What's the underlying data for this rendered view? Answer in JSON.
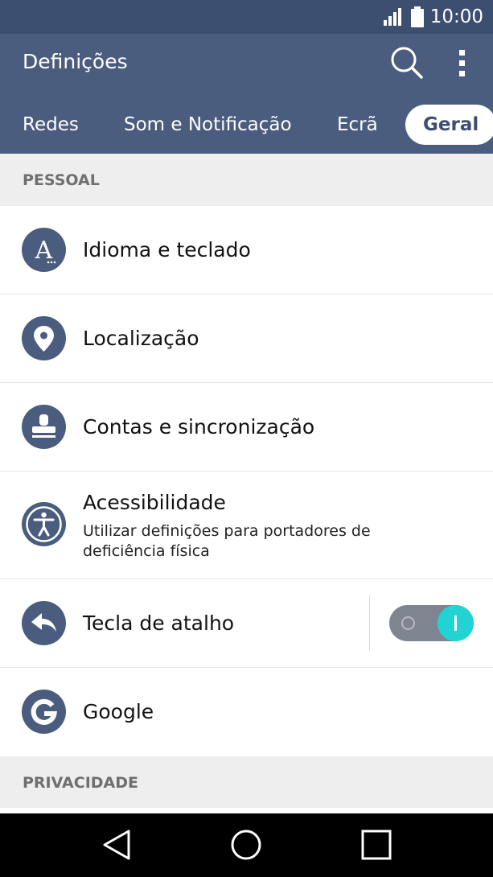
{
  "status_bar": {
    "time": "10:00",
    "icons": [
      "signal-icon",
      "battery-icon"
    ]
  },
  "app_bar": {
    "title": "Definições",
    "actions": [
      "search-icon",
      "more-vert-icon"
    ],
    "tabs": [
      {
        "label": "Redes",
        "active": false
      },
      {
        "label": "Som e Notificação",
        "active": false
      },
      {
        "label": "Ecrã",
        "active": false
      },
      {
        "label": "Geral",
        "active": true
      }
    ]
  },
  "sections": {
    "personal": {
      "header": "PESSOAL",
      "items": [
        {
          "title": "Idioma e teclado",
          "icon": "language-icon"
        },
        {
          "title": "Localização",
          "icon": "location-pin-icon"
        },
        {
          "title": "Contas e sincronização",
          "icon": "accounts-stamp-icon"
        },
        {
          "title": "Acessibilidade",
          "subtitle": "Utilizar definições para portadores de deficiência física",
          "icon": "accessibility-icon"
        },
        {
          "title": "Tecla de atalho",
          "icon": "shortcut-key-icon",
          "toggle": true
        },
        {
          "title": "Google",
          "icon": "google-icon"
        }
      ]
    },
    "privacy": {
      "header": "PRIVACIDADE"
    }
  },
  "nav_bar": {
    "buttons": [
      "back-icon",
      "home-icon",
      "recents-icon"
    ]
  },
  "colors": {
    "app_bar": "#4b5d7e",
    "status_bar": "#3d4f70",
    "icon_circle": "#4b5d7e",
    "toggle_on": "#22d3d3",
    "section_bg": "#eeeeee"
  }
}
